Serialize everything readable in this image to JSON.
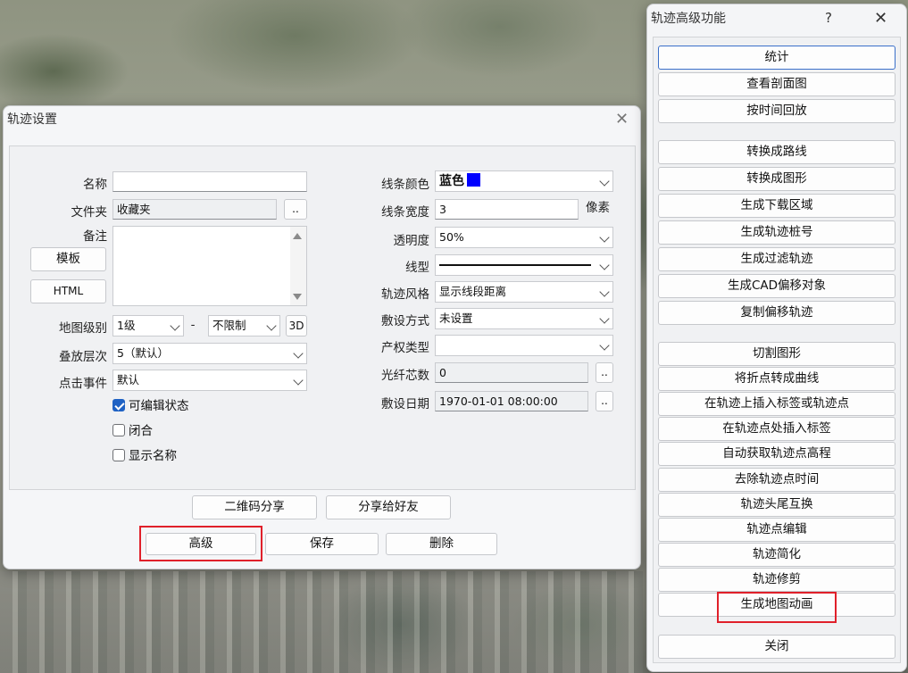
{
  "track_settings": {
    "title": "轨迹设置",
    "close_glyph": "✕",
    "left": {
      "name_label": "名称",
      "name_value": "",
      "folder_label": "文件夹",
      "folder_value": "收藏夹",
      "browse_label": "..",
      "notes_label": "备注",
      "template_button": "模板",
      "html_button": "HTML",
      "map_level_label": "地图级别",
      "map_level_value": "1级",
      "map_level_sep": "-",
      "map_level_max": "不限制",
      "three_d_button": "3D",
      "layer_label": "叠放层次",
      "layer_value": "5（默认）",
      "click_event_label": "点击事件",
      "click_event_value": "默认",
      "cb_editable": "可编辑状态",
      "cb_closed": "闭合",
      "cb_show_name": "显示名称"
    },
    "right": {
      "line_color_label": "线条颜色",
      "line_color_value": "蓝色",
      "line_color_swatch": "#0000ff",
      "line_width_label": "线条宽度",
      "line_width_value": "3",
      "line_width_unit": "像素",
      "opacity_label": "透明度",
      "opacity_value": "50%",
      "line_type_label": "线型",
      "track_style_label": "轨迹风格",
      "track_style_value": "显示线段距离",
      "laying_label": "敷设方式",
      "laying_value": "未设置",
      "property_label": "产权类型",
      "property_value": "",
      "fiber_label": "光纤芯数",
      "fiber_value": "0",
      "date_label": "敷设日期",
      "date_value": "1970-01-01 08:00:00",
      "browse_label": ".."
    },
    "buttons": {
      "qr_share": "二维码分享",
      "share_friend": "分享给好友",
      "advanced": "高级",
      "save": "保存",
      "delete": "删除"
    },
    "checks": {
      "editable": true,
      "closed": false,
      "show_name": false
    }
  },
  "advanced": {
    "title": "轨迹高级功能",
    "help_glyph": "?",
    "close_glyph": "✕",
    "group1": [
      "统计",
      "查看剖面图",
      "按时间回放"
    ],
    "group2": [
      "转换成路线",
      "转换成图形",
      "生成下载区域",
      "生成轨迹桩号",
      "生成过滤轨迹",
      "生成CAD偏移对象",
      "复制偏移轨迹"
    ],
    "group3": [
      "切割图形",
      "将折点转成曲线",
      "在轨迹上插入标签或轨迹点",
      "在轨迹点处插入标签",
      "自动获取轨迹点高程",
      "去除轨迹点时间",
      "轨迹头尾互换",
      "轨迹点编辑",
      "轨迹简化",
      "轨迹修剪",
      "生成地图动画"
    ],
    "close_button": "关闭"
  },
  "colors": {
    "highlight": "#e0202a",
    "checkbox": "#1f62c4"
  }
}
